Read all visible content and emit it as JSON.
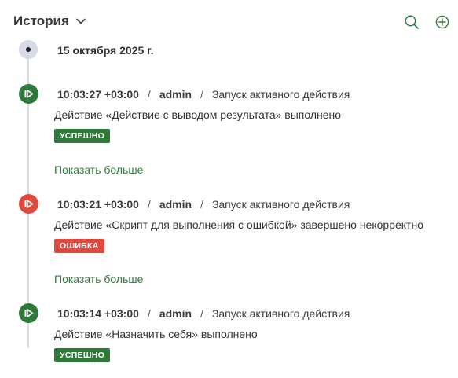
{
  "header": {
    "title": "История",
    "icons": [
      "chevron-down-icon",
      "search-icon",
      "add-circle-icon"
    ],
    "accent_color": "#2f7a3a"
  },
  "timeline": {
    "date": "15 октября 2025 г.",
    "events": [
      {
        "status": "success",
        "time": "10:03:27 +03:00",
        "separator": "/",
        "user": "admin",
        "action": "Запуск активного действия",
        "description": "Действие «Действие с выводом результата» выполнено",
        "badge": "УСПЕШНО",
        "show_more": "Показать больше"
      },
      {
        "status": "error",
        "time": "10:03:21 +03:00",
        "separator": "/",
        "user": "admin",
        "action": "Запуск активного действия",
        "description": "Действие «Скрипт для выполнения с ошибкой» завершено некорректно",
        "badge": "ОШИБКА",
        "show_more": "Показать больше"
      },
      {
        "status": "success",
        "time": "10:03:14 +03:00",
        "separator": "/",
        "user": "admin",
        "action": "Запуск активного действия",
        "description": "Действие «Назначить себя» выполнено",
        "badge": "УСПЕШНО"
      }
    ]
  },
  "colors": {
    "success": "#2f7a3a",
    "error": "#df4a3f",
    "timeline": "#d9dce2"
  }
}
